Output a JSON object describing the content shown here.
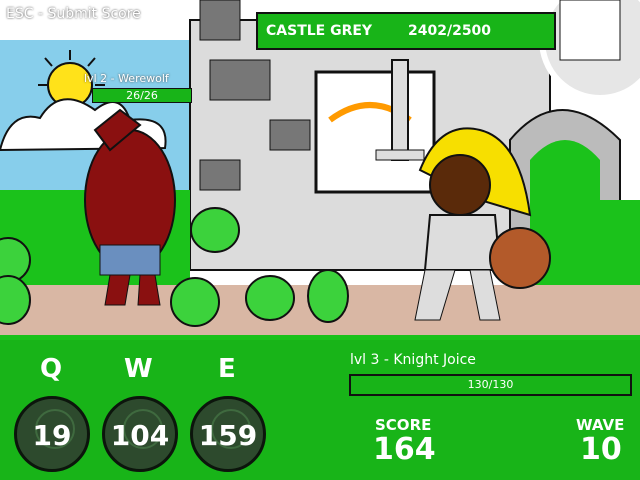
{
  "hud": {
    "esc_hint": "ESC - Submit Score",
    "castle": {
      "name": "CASTLE GREY",
      "hp": "2402/2500"
    },
    "enemy": {
      "label": "lvl 2 - Werewolf",
      "hp": "26/26"
    },
    "hero": {
      "label": "lvl 3 - Knight Joice",
      "hp": "130/130"
    },
    "score_label": "SCORE",
    "score": "164",
    "wave_label": "WAVE",
    "wave": "10"
  },
  "abilities": [
    {
      "key": "Q",
      "count": "19"
    },
    {
      "key": "W",
      "count": "104"
    },
    {
      "key": "E",
      "count": "159"
    }
  ],
  "colors": {
    "hud_green": "#18b418",
    "grass": "#1bc21b",
    "sky": "#87ceeb",
    "path": "#d9b7a4",
    "castle": "#dcdcdc",
    "werewolf": "#8a1010",
    "slime": "#3cd23c",
    "hair": "#f7df00"
  }
}
